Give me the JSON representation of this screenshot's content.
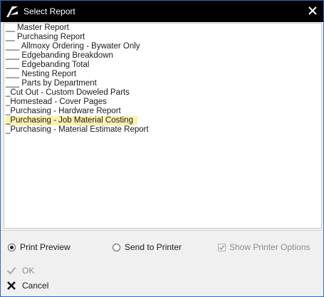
{
  "window": {
    "title": "Select Report"
  },
  "reports": [
    {
      "label": "__ Master Report",
      "selected": false
    },
    {
      "label": "__ Purchasing Report",
      "selected": false
    },
    {
      "label": "___ Allmoxy Ordering - Bywater Only",
      "selected": false
    },
    {
      "label": "___ Edgebanding Breakdown",
      "selected": false
    },
    {
      "label": "___ Edgebanding Total",
      "selected": false
    },
    {
      "label": "___ Nesting Report",
      "selected": false
    },
    {
      "label": "___ Parts by Department",
      "selected": false
    },
    {
      "label": "_Cut Out - Custom Doweled Parts",
      "selected": false
    },
    {
      "label": "_Homestead - Cover Pages",
      "selected": false
    },
    {
      "label": "_Purchasing - Hardware Report",
      "selected": false
    },
    {
      "label": "_Purchasing - Job Material Costing",
      "selected": true
    },
    {
      "label": "_Purchasing - Material Estimate Report",
      "selected": false
    }
  ],
  "options": {
    "print_preview": "Print Preview",
    "send_to_printer": "Send to Printer",
    "show_printer_options": "Show Printer Options",
    "selected_output": "print_preview",
    "show_printer_options_checked": true,
    "show_printer_options_enabled": false
  },
  "actions": {
    "ok": "OK",
    "cancel": "Cancel",
    "ok_enabled": false
  },
  "colors": {
    "titlebar": "#000000",
    "selection": "#fbf1ad",
    "window_border": "#2b6cc4",
    "background": "#f0f0f0"
  },
  "icons": {
    "app": "app-logo-icon",
    "close": "close-icon",
    "ok": "checkmark-icon",
    "cancel": "cancel-x-icon"
  }
}
